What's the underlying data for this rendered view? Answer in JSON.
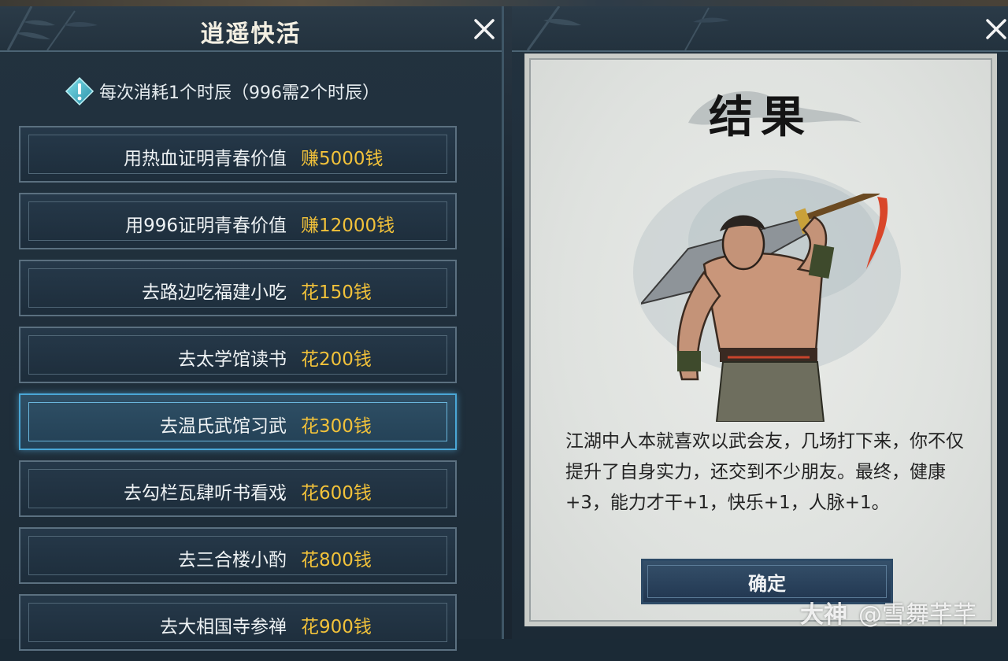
{
  "left_panel": {
    "title": "逍遥快活",
    "cost_note": "每次消耗1个时辰（996需2个时辰）",
    "options": [
      {
        "label": "用热血证明青春价值",
        "cost": "赚5000钱"
      },
      {
        "label": "用996证明青春价值",
        "cost": "赚12000钱"
      },
      {
        "label": "去路边吃福建小吃",
        "cost": "花150钱"
      },
      {
        "label": "去太学馆读书",
        "cost": "花200钱"
      },
      {
        "label": "去温氏武馆习武",
        "cost": "花300钱"
      },
      {
        "label": "去勾栏瓦肆听书看戏",
        "cost": "花600钱"
      },
      {
        "label": "去三合楼小酌",
        "cost": "花800钱"
      },
      {
        "label": "去大相国寺参禅",
        "cost": "花900钱"
      }
    ],
    "selected_index": 4
  },
  "result_panel": {
    "title": "结果",
    "text": "江湖中人本就喜欢以武会友，几场打下来，你不仅提升了自身实力，还交到不少朋友。最终，健康+3，能力才干+1，快乐+1，人脉+1。",
    "confirm_label": "确定"
  },
  "watermark": {
    "brand": "大神",
    "author": "@雪舞芊芊"
  },
  "colors": {
    "accent_cost": "#f2c23a",
    "selected_border": "#4aa7d6",
    "panel_bg": "#22323f"
  },
  "icons": {
    "close": "close-icon",
    "cost": "warning-diamond-icon"
  }
}
